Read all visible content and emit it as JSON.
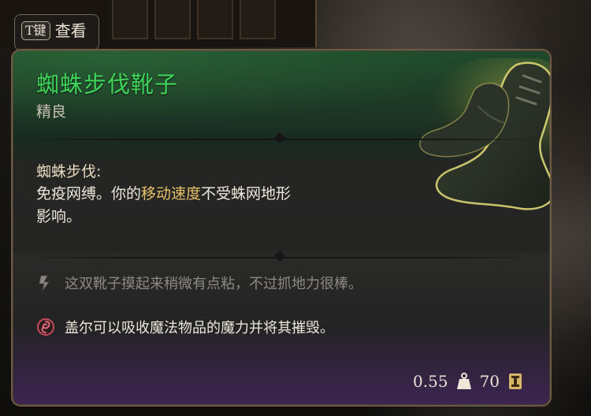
{
  "hint": {
    "key": "T键",
    "label": "查看"
  },
  "item": {
    "name": "蜘蛛步伐靴子",
    "rarity": "精良",
    "rarity_color": "#3fd35a",
    "icon": "spiderstep-boots-icon"
  },
  "effect": {
    "title": "蜘蛛步伐:",
    "desc_part1": "免疫网缚。你的",
    "keyword": "移动速度",
    "desc_part2": "不受蛛网地形",
    "desc_part3": "影响。"
  },
  "lore": {
    "flavor_text": "这双靴子摸起来稍微有点粘，不过抓地力很棒。",
    "flavor_icon": "quill-icon",
    "gale_text": "盖尔可以吸收魔法物品的魔力并将其摧毁。",
    "gale_icon": "magic-swirl-icon"
  },
  "stats": {
    "weight": "0.55",
    "weight_icon": "weight-icon",
    "value": "70",
    "value_icon": "gold-coin-icon"
  }
}
